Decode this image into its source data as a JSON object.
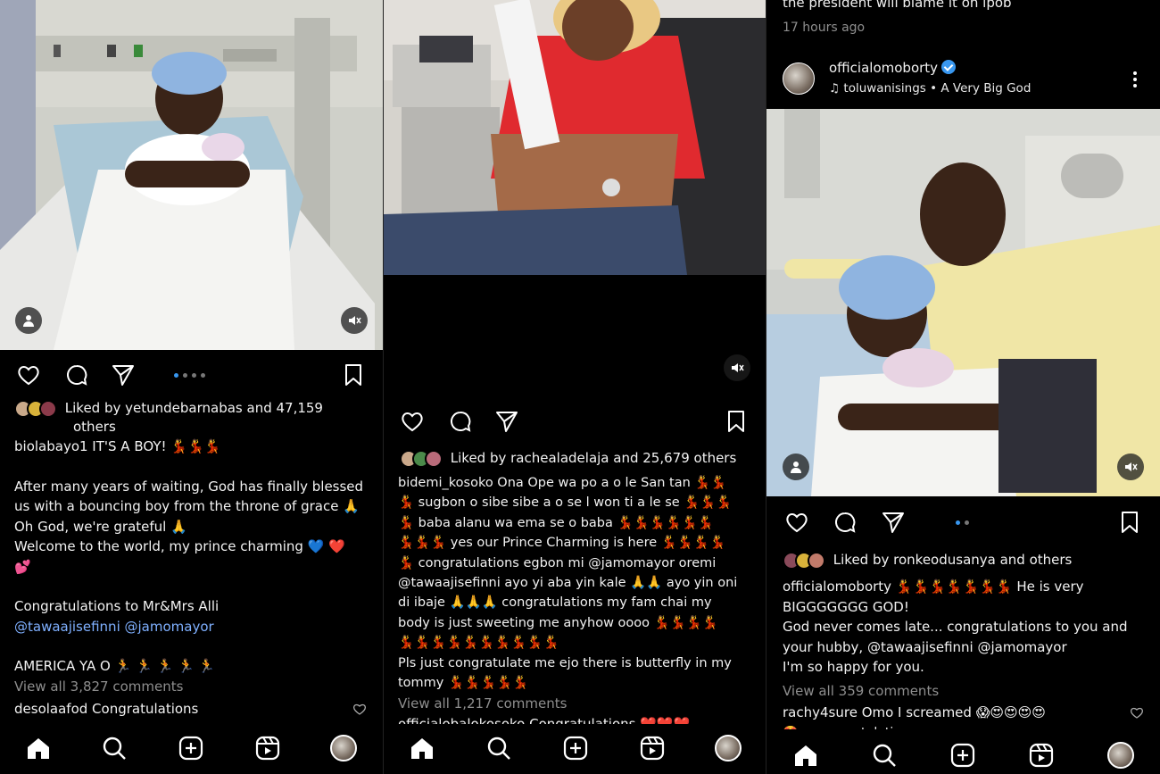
{
  "panel1": {
    "caption": {
      "line1": "biolabayo1 IT'S A BOY! 💃💃💃",
      "line2": "After many years of waiting, God has finally blessed",
      "line3": "us with a bouncing boy from the throne of grace 🙏",
      "line4": "Oh God, we're grateful 🙏",
      "line5": "Welcome to the world, my prince charming 💙 ❤️",
      "line6": "💕",
      "line7": "Congratulations to Mr&Mrs Alli",
      "tags": "@tawaajisefinni @jamomayor",
      "line8": "AMERICA YA O 🏃 🏃 🏃 🏃 🏃"
    },
    "liked": "Liked by yetundebarnabas and 47,159",
    "liked_cont": "others",
    "view_comments": "View all 3,827 comments",
    "top_comment": "desolaafod Congratulations",
    "carousel_dots": 4
  },
  "panel2": {
    "liked": "Liked by rachealadelaja and 25,679 others",
    "caption": [
      "bidemi_kosoko Ona Ope wa po a o le San tan 💃💃",
      "💃 sugbon o sibe sibe a o se l won ti a le se 💃💃💃",
      "💃 baba alanu wa ema se o baba 💃💃💃💃💃💃",
      "💃💃💃 yes our Prince Charming is here 💃💃💃💃",
      "💃 congratulations egbon mi @jamomayor oremi",
      "@tawaajisefinni  ayo yi aba yin kale 🙏🙏  ayo yin oni",
      "di ibaje 🙏🙏🙏 congratulations my fam  chai my",
      "body is just sweeting me anyhow oooo 💃💃💃💃",
      "💃💃💃💃💃💃💃💃💃💃",
      " Pls just congratulate me ejo there is butterfly in my",
      "tommy 💃💃💃💃💃"
    ],
    "view_comments": "View all 1,217 comments",
    "top_comment": "officialobalokosoko Congratulations ❤️❤️❤️"
  },
  "panel3": {
    "prev_caption": "the president will blame it on ipob",
    "prev_time": "17 hours ago",
    "username": "officialomoborty",
    "music": "toluwanisings • A Very Big God",
    "liked": "Liked by ronkeodusanya and others",
    "caption": [
      "officialomoborty 💃💃💃💃💃💃💃 He is very",
      "BIGGGGGGG GOD!",
      "God never comes late... congratulations to you and",
      "your hubby, @tawaajisefinni @jamomayor",
      "I'm so happy for you."
    ],
    "view_comments": "View all 359 comments",
    "top_comment": "rachy4sure Omo I screamed 😱😍😍😍😍",
    "second_comment": "🤩 ... congratulating",
    "carousel_dots": 2
  },
  "icons": {
    "like": "heart-icon",
    "comment": "comment-icon",
    "share": "send-icon",
    "save": "bookmark-icon",
    "home": "home-icon",
    "search": "search-icon",
    "create": "plus-square-icon",
    "reels": "reels-icon",
    "mute": "mute-icon",
    "tag": "user-tag-icon",
    "more": "more-icon",
    "music": "music-note-icon"
  },
  "colors": {
    "background": "#000000",
    "text": "#f2f2f2",
    "muted": "#8e8e8e",
    "link": "#7fb0ff",
    "accent": "#3897f0"
  }
}
